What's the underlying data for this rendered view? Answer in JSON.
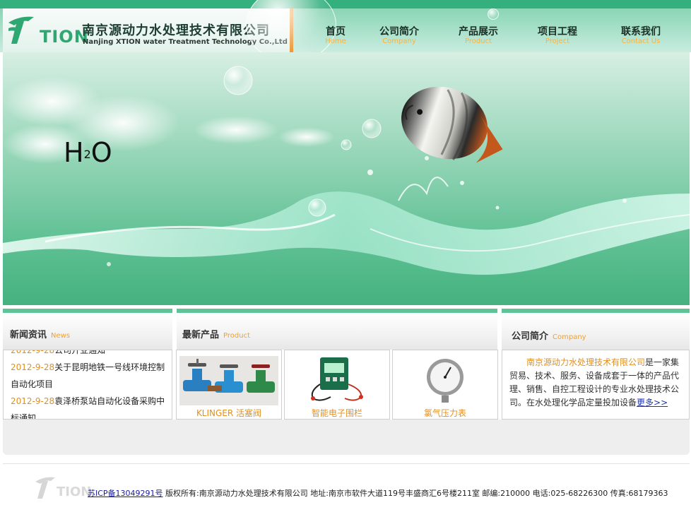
{
  "header": {
    "logo_text": "TION",
    "company_cn": "南京源动力水处理技术有限公司",
    "company_en": "Nanjing XTION water Treatment Technology Co.,Ltd"
  },
  "nav": [
    {
      "cn": "首页",
      "en": "Home"
    },
    {
      "cn": "公司简介",
      "en": "Company"
    },
    {
      "cn": "产品展示",
      "en": "Product"
    },
    {
      "cn": "项目工程",
      "en": "Project"
    },
    {
      "cn": "联系我们",
      "en": "Contact Us"
    }
  ],
  "banner": {
    "h": "H",
    "sub": "2",
    "o": "O"
  },
  "news": {
    "title": "新闻资讯",
    "subtitle": "News",
    "items": [
      {
        "date": "2012-9-28",
        "text": "公司开业通知"
      },
      {
        "date": "2012-9-28",
        "text": "关于昆明地铁一号线环境控制自动化项目"
      },
      {
        "date": "2012-9-28",
        "text": "袁泽桥泵站自动化设备采购中标通知"
      }
    ]
  },
  "products": {
    "title": "最新产品",
    "subtitle": "Product",
    "items": [
      {
        "name": "KLINGER 活塞阀",
        "icon": "valve-icon"
      },
      {
        "name": "智能电子围栏",
        "icon": "electric-fence-icon"
      },
      {
        "name": "氯气压力表",
        "icon": "pressure-gauge-icon"
      }
    ]
  },
  "intro": {
    "title": "公司简介",
    "subtitle": "Company",
    "company": "南京源动力水处理技术有限公司",
    "text": "是一家集贸易、技术、服务、设备成套于一体的产品代理、销售、自控工程设计的专业水处理技术公司。在水处理化学品定量投加设备",
    "more": "更多>>"
  },
  "footer": {
    "logo_text": "TION",
    "icp": "苏ICP备13049291号",
    "text": " 版权所有:南京源动力水处理技术有限公司 地址:南京市软件大道119号丰盛商汇6号楼211室 邮编:210000 电话:025-68226300 传真:68179363"
  },
  "colors": {
    "brand_green": "#34b07e",
    "accent_orange": "#e98a1a",
    "link_blue": "#1a1aa0"
  }
}
